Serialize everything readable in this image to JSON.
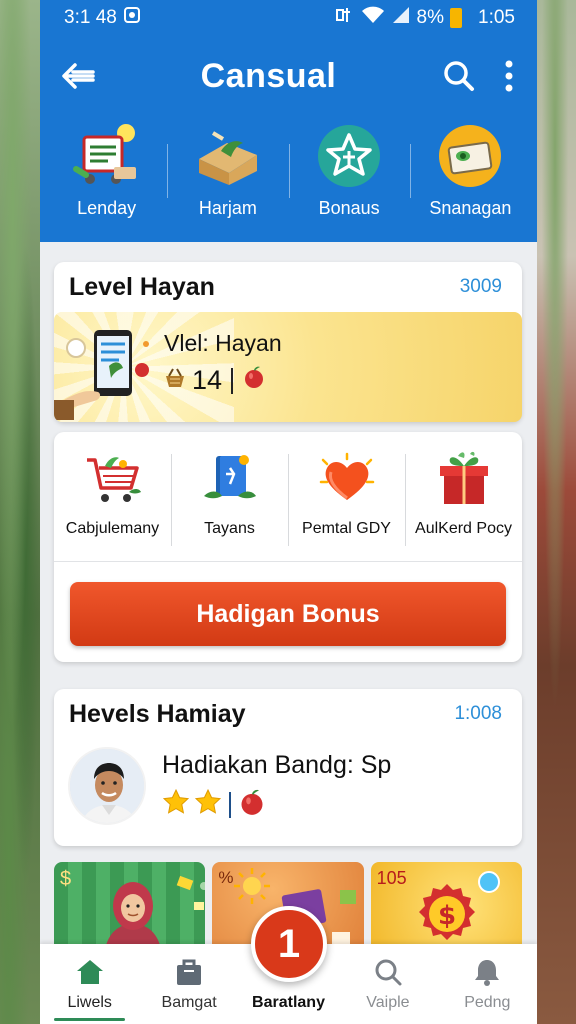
{
  "status": {
    "left_text": "3:1 48",
    "battery_text": "8%",
    "time": "1:05"
  },
  "appbar": {
    "title": "Cansual",
    "back_icon": "back-arrow-icon",
    "search_icon": "search-icon",
    "more_icon": "more-vert-icon"
  },
  "categories": [
    {
      "label": "Lenday",
      "icon": "shopping-cart-icon"
    },
    {
      "label": "Harjam",
      "icon": "package-icon"
    },
    {
      "label": "Bonaus",
      "icon": "star-badge-icon"
    },
    {
      "label": "Snanagan",
      "icon": "cash-icon"
    }
  ],
  "level_card": {
    "title": "Level Hayan",
    "number": "3009",
    "banner_name": "Vlel: Hayan",
    "banner_count": "14"
  },
  "features": [
    {
      "label": "Cabjulemany",
      "icon": "cart-icon"
    },
    {
      "label": "Tayans",
      "icon": "book-icon"
    },
    {
      "label": "Pemtal GDY",
      "icon": "heart-icon"
    },
    {
      "label": "AulKerd Pocy",
      "icon": "gift-box-icon"
    }
  ],
  "bonus_button": "Hadigan Bonus",
  "levels_card": {
    "title": "Hevels Hamiay",
    "number": "1:008",
    "name": "Hadiakan Bandg: Sp"
  },
  "promos": [
    {
      "label": "$"
    },
    {
      "label": "%"
    },
    {
      "label": "105"
    }
  ],
  "fab_label": "1",
  "bottom_nav": [
    {
      "label": "Liwels",
      "icon": "home-icon"
    },
    {
      "label": "Bamgat",
      "icon": "bag-icon"
    },
    {
      "label": "Baratlany",
      "icon": "fab-icon"
    },
    {
      "label": "Vaiple",
      "icon": "search-icon"
    },
    {
      "label": "Pedng",
      "icon": "bell-icon"
    }
  ],
  "colors": {
    "primary": "#1976d2",
    "accent": "#d9391a",
    "link": "#2d8fd8",
    "active": "#2e8b57"
  }
}
